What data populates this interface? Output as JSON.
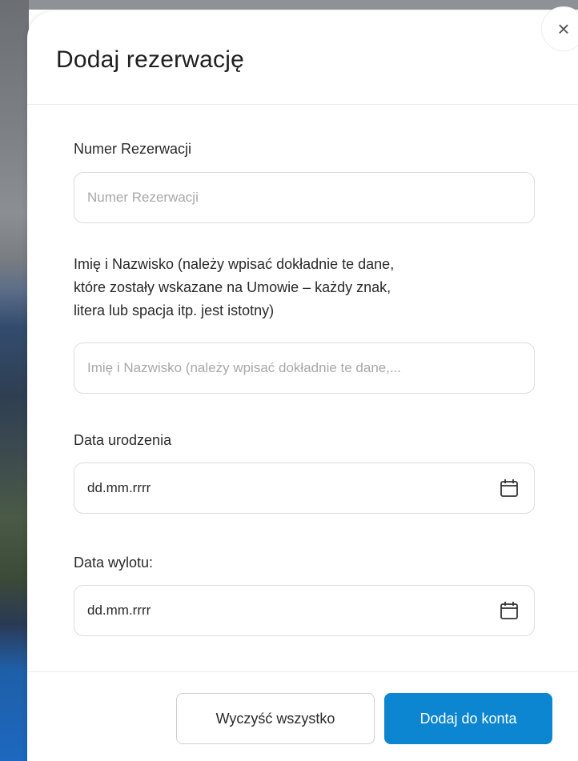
{
  "modal": {
    "title": "Dodaj rezerwację",
    "close_symbol": "×"
  },
  "form": {
    "reservation_number": {
      "label": "Numer Rezerwacji",
      "placeholder": "Numer Rezerwacji",
      "value": ""
    },
    "full_name": {
      "label_line1": "Imię i Nazwisko (należy wpisać dokładnie te dane,",
      "label_line2": "które zostały wskazane na Umowie – każdy znak,",
      "label_line3": "litera lub spacja itp. jest istotny)",
      "placeholder": "Imię i Nazwisko (należy wpisać dokładnie te dane,..."
    },
    "birth_date": {
      "label": "Data urodzenia",
      "value": "dd.mm.rrrr"
    },
    "departure_date": {
      "label": "Data wylotu:",
      "value": "dd.mm.rrrr"
    }
  },
  "footer": {
    "clear_label": "Wyczyść wszystko",
    "submit_label": "Dodaj do konta"
  },
  "colors": {
    "primary": "#0c86d1",
    "border": "#dcdcdc",
    "placeholder": "#a8a8a8"
  },
  "icons": [
    "close-icon",
    "calendar-icon"
  ]
}
